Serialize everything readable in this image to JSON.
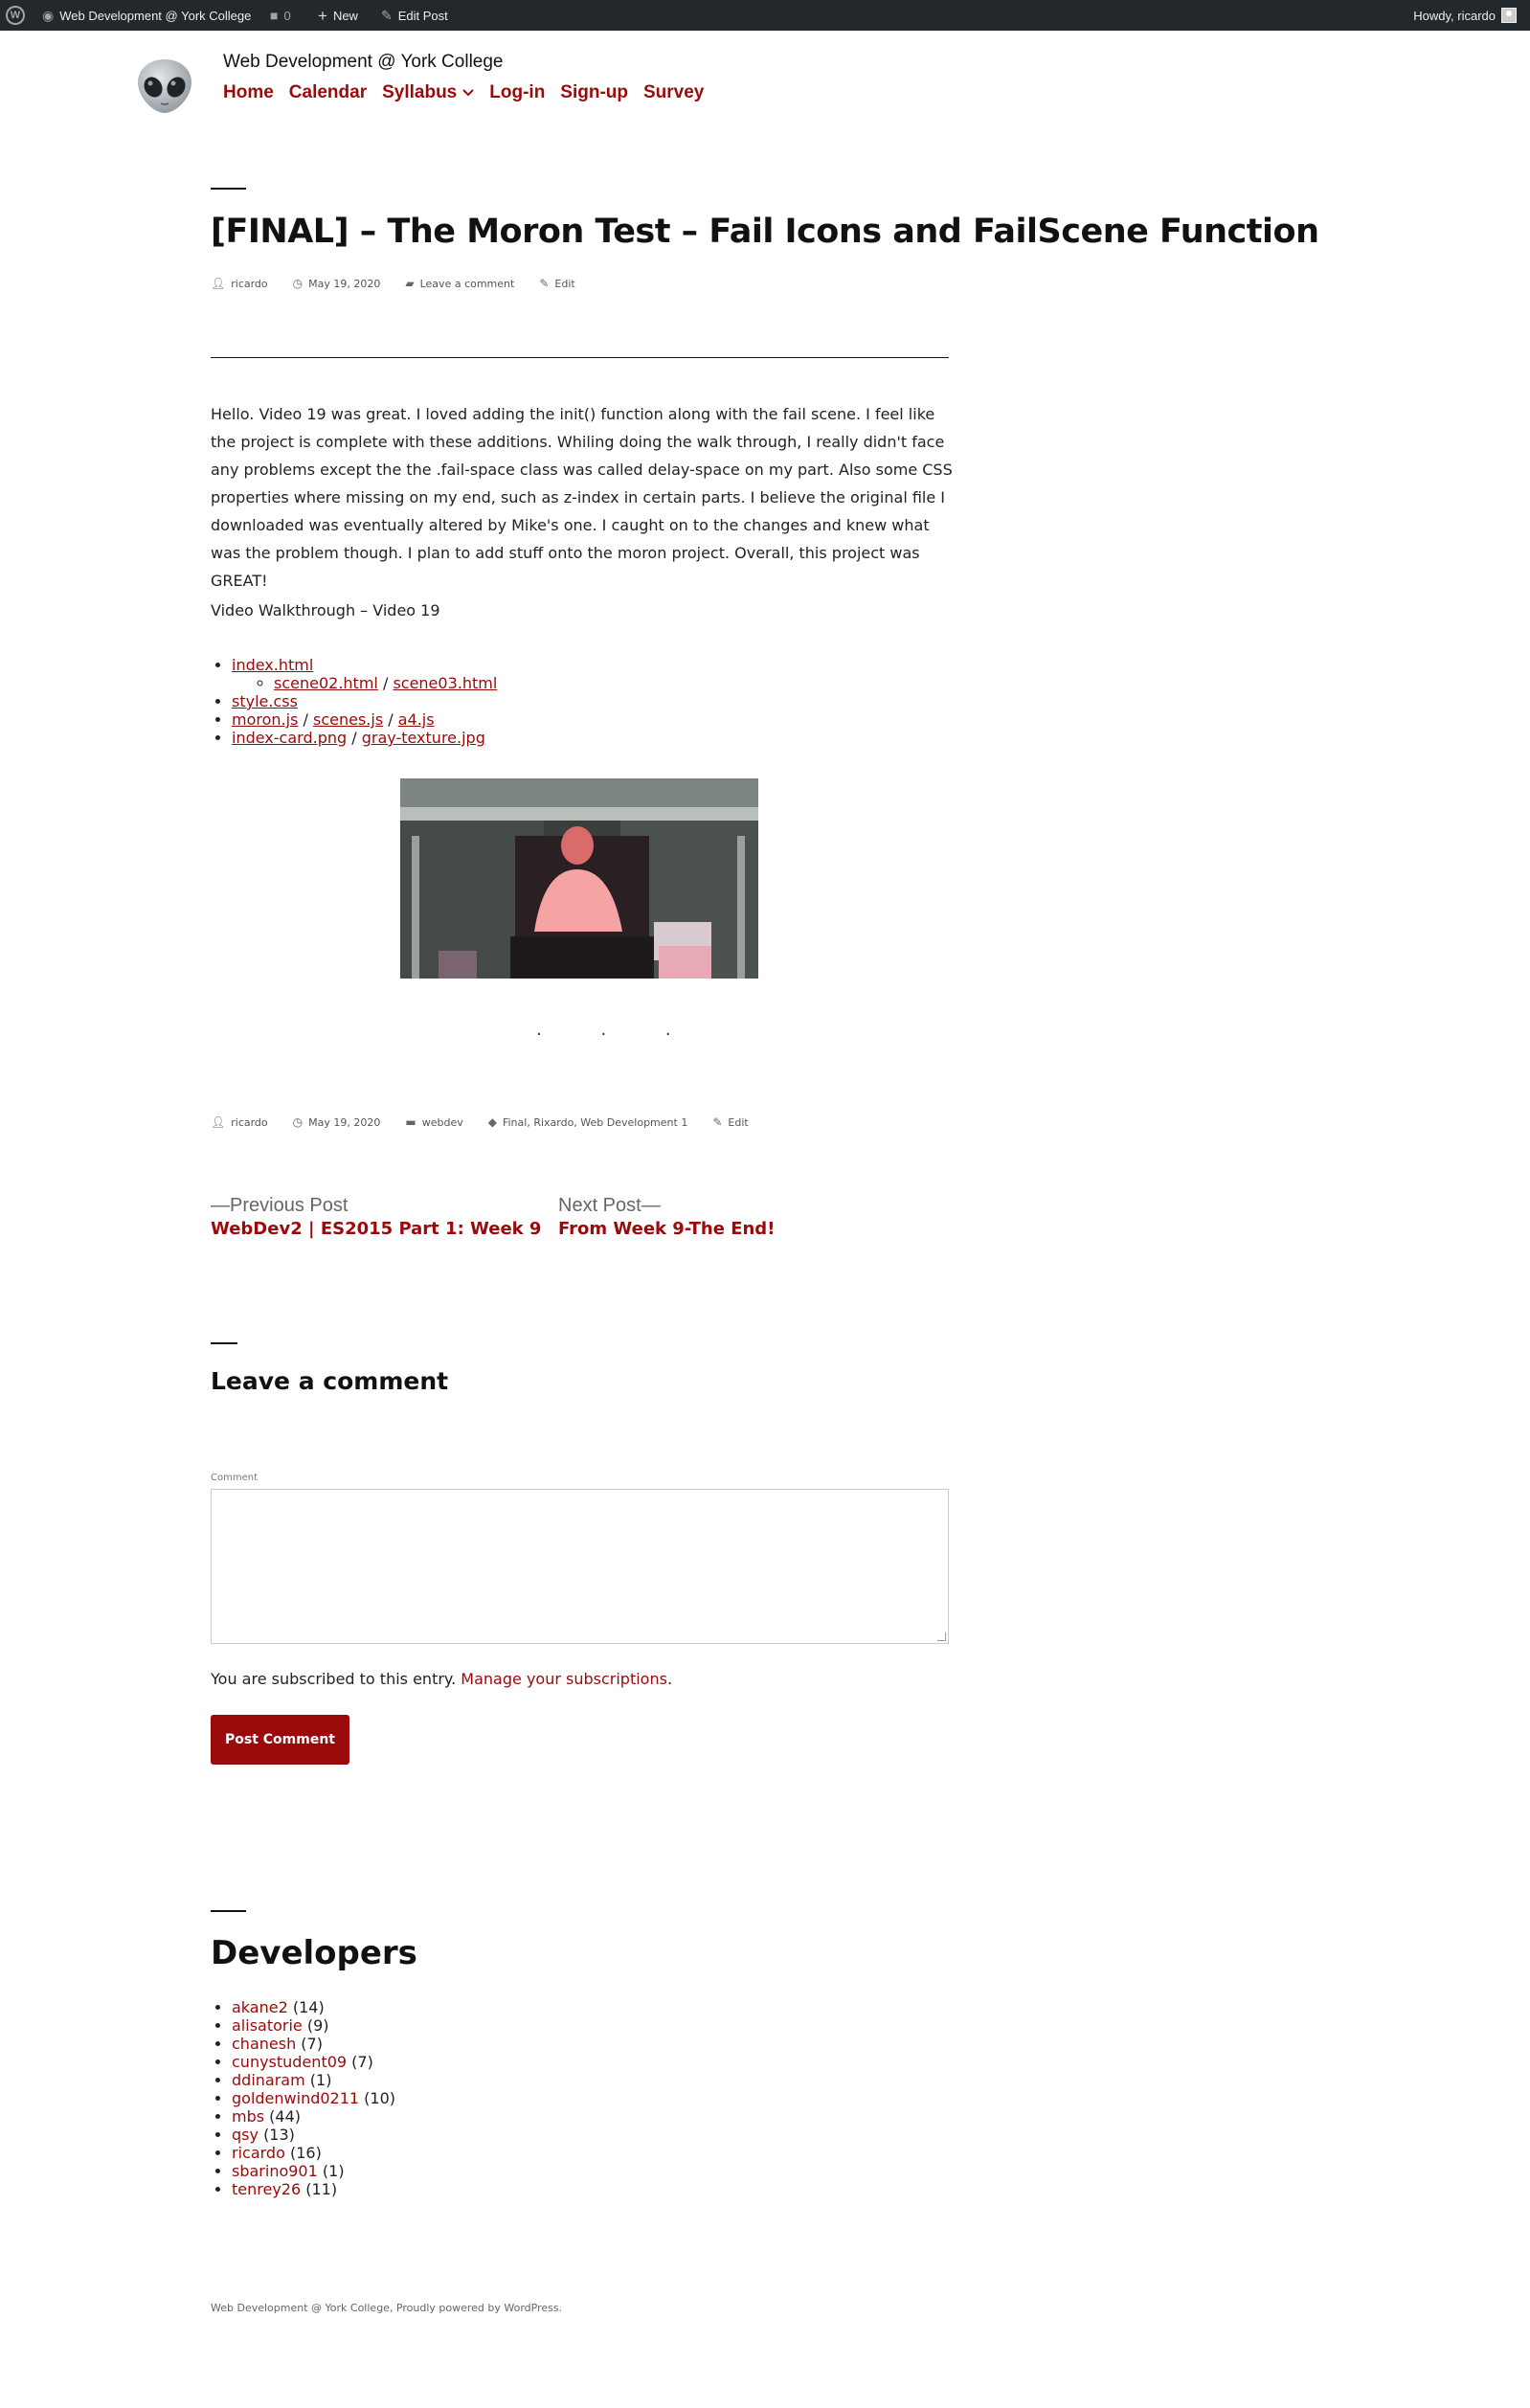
{
  "adminbar": {
    "site_name": "Web Development @ York College",
    "comments_count": "0",
    "new_label": "New",
    "edit_label": "Edit Post",
    "howdy": "Howdy, ricardo"
  },
  "header": {
    "site_title": "Web Development @ York College",
    "logo_icon": "alien-emoji-icon",
    "nav": {
      "home": "Home",
      "calendar": "Calendar",
      "syllabus": "Syllabus",
      "login": "Log-in",
      "signup": "Sign-up",
      "survey": "Survey"
    }
  },
  "post": {
    "title": "[FINAL] – The Moron Test – Fail Icons and FailScene Function",
    "meta_top": {
      "author": "ricardo",
      "date": "May 19, 2020",
      "comment": "Leave a comment",
      "edit": "Edit"
    },
    "body": "Hello. Video 19 was great. I loved adding the init() function along with the fail scene. I feel like the project is complete with these additions. Whiling doing the walk through, I really didn't face any problems except the the .fail-space class was called delay-space on my part. Also some CSS properties where missing on my end, such as z-index in certain parts. I believe the original file I downloaded was eventually altered by Mike's one. I caught on to the changes and knew what was the problem though. I plan to add stuff onto the moron project. Overall, this project was GREAT!",
    "walkthrough": "Video Walkthrough – Video 19",
    "files": {
      "index": "index.html",
      "scene02": "scene02.html",
      "scene03": "scene03.html",
      "style": "style.css",
      "moron": "moron.js",
      "scenes": "scenes.js",
      "a4": "a4.js",
      "indexcard": "index-card.png",
      "graytexture": "gray-texture.jpg",
      "sep": "/"
    },
    "dots": "· · ·",
    "meta_bottom": {
      "author": "ricardo",
      "date": "May 19, 2020",
      "category": "webdev",
      "tags": "Final, Rixardo, Web Development 1",
      "edit": "Edit"
    }
  },
  "post_nav": {
    "prev_label": "—Previous Post",
    "prev_title": "WebDev2 | ES2015 Part 1: Week 9",
    "next_label": "Next Post—",
    "next_title": "From Week 9-The End!"
  },
  "comments": {
    "heading": "Leave a comment",
    "label": "Comment",
    "subscribed_text": "You are subscribed to this entry.",
    "manage_link": "Manage your subscriptions",
    "period": ".",
    "submit": "Post Comment"
  },
  "developers": {
    "heading": "Developers",
    "list": [
      {
        "name": "akane2",
        "count": "(14)"
      },
      {
        "name": "alisatorie",
        "count": "(9)"
      },
      {
        "name": "chanesh",
        "count": "(7)"
      },
      {
        "name": "cunystudent09",
        "count": "(7)"
      },
      {
        "name": "ddinaram",
        "count": "(1)"
      },
      {
        "name": "goldenwind0211",
        "count": "(10)"
      },
      {
        "name": "mbs",
        "count": "(44)"
      },
      {
        "name": "qsy",
        "count": "(13)"
      },
      {
        "name": "ricardo",
        "count": "(16)"
      },
      {
        "name": "sbarino901",
        "count": "(1)"
      },
      {
        "name": "tenrey26",
        "count": "(11)"
      }
    ]
  },
  "footer": {
    "text": "Web Development @ York College, Proudly powered by WordPress."
  }
}
